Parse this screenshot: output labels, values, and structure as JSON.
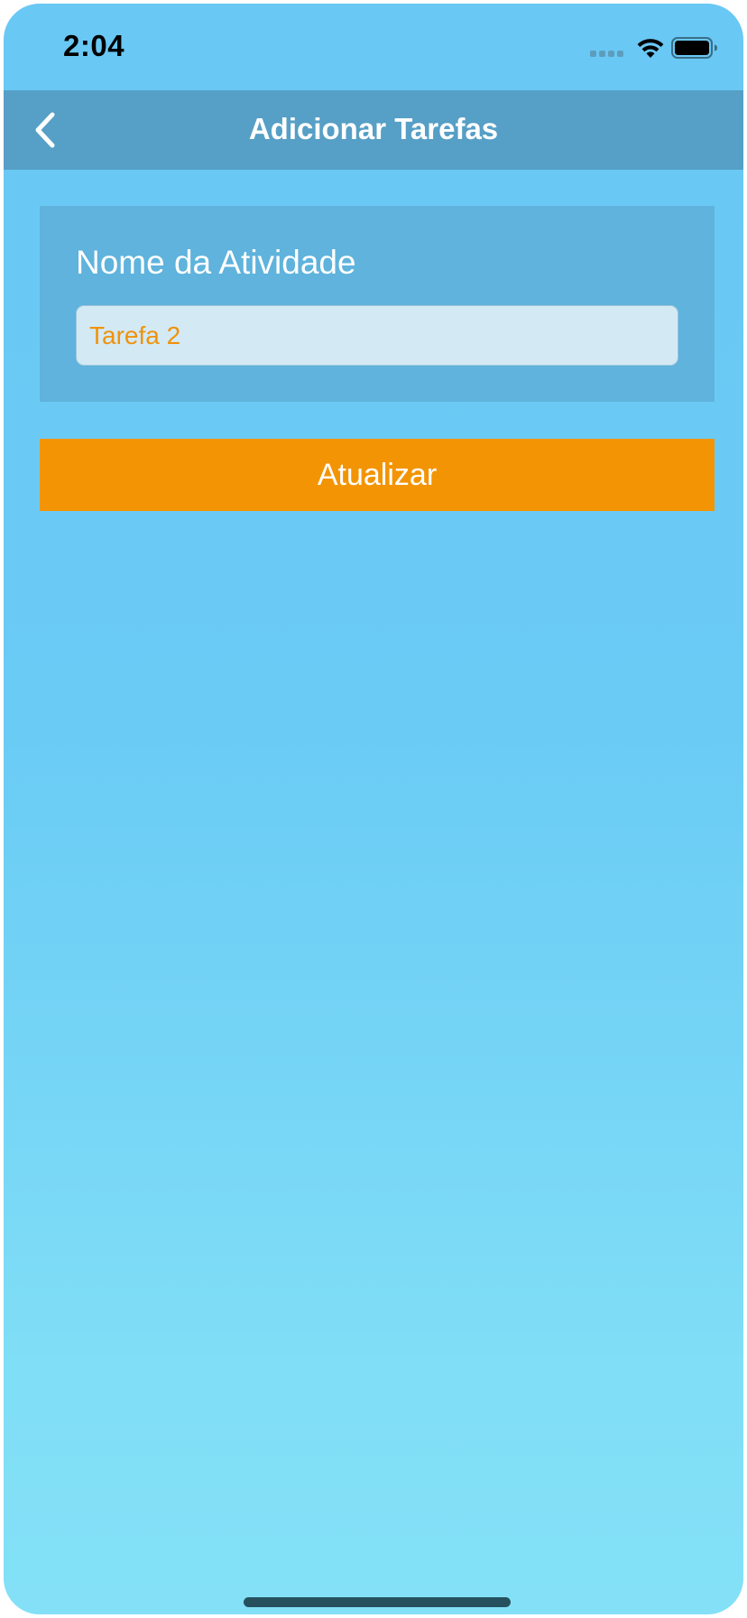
{
  "status_bar": {
    "time": "2:04",
    "signal_icon": "cellular-signal-icon",
    "wifi_icon": "wifi-icon",
    "battery_icon": "battery-icon"
  },
  "nav": {
    "back_icon": "chevron-left-icon",
    "title": "Adicionar Tarefas"
  },
  "form": {
    "label": "Nome da Atividade",
    "input_value": "Tarefa 2"
  },
  "actions": {
    "update_label": "Atualizar"
  },
  "colors": {
    "background_top": "#69c8f4",
    "background_bottom": "#83e0f7",
    "nav_bar": "#569fc6",
    "card": "#5fb3dc",
    "input_bg": "#d3e9f4",
    "input_text": "#f0920a",
    "accent_button": "#f39404"
  }
}
